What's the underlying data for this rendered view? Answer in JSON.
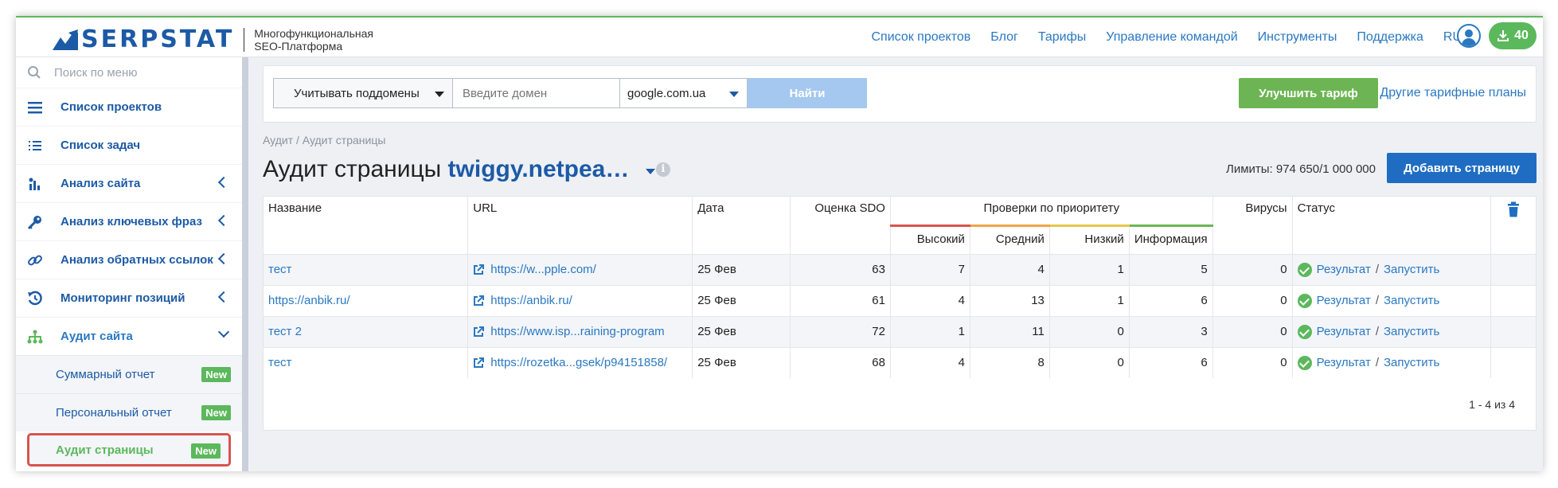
{
  "header": {
    "logo_text": "SERPSTAT",
    "logo_sub_line1": "Многофункциональная",
    "logo_sub_line2": "SEO-Платформа",
    "nav": [
      "Список проектов",
      "Блог",
      "Тарифы",
      "Управление командой",
      "Инструменты",
      "Поддержка"
    ],
    "lang": "RU",
    "download_count": "40"
  },
  "sidebar": {
    "search_placeholder": "Поиск по меню",
    "items": [
      {
        "label": "Список проектов",
        "icon": "list-icon"
      },
      {
        "label": "Список задач",
        "icon": "tasks-icon"
      },
      {
        "label": "Анализ сайта",
        "icon": "bar-chart-icon"
      },
      {
        "label": "Анализ ключевых фраз",
        "icon": "key-icon"
      },
      {
        "label": "Анализ обратных ссылок",
        "icon": "link-icon"
      },
      {
        "label": "Мониторинг позиций",
        "icon": "history-icon"
      },
      {
        "label": "Аудит сайта",
        "icon": "sitemap-icon"
      }
    ],
    "subitems": [
      {
        "label": "Суммарный отчет",
        "badge": "New"
      },
      {
        "label": "Персональный отчет",
        "badge": "New"
      },
      {
        "label": "Аудит страницы",
        "badge": "New"
      }
    ]
  },
  "search": {
    "subdomains_label": "Учитывать поддомены",
    "domain_placeholder": "Введите домен",
    "engine": "google.com.ua",
    "find_label": "Найти",
    "upgrade_label": "Улучшить тариф",
    "plans_link": "Другие тарифные планы"
  },
  "page": {
    "breadcrumb": "Аудит / Аудит страницы",
    "title": "Аудит страницы",
    "domain": "twiggy.netpea…",
    "limits": "Лимиты: 974 650/1 000 000",
    "add_label": "Добавить страницу"
  },
  "table": {
    "headers": {
      "name": "Название",
      "url": "URL",
      "date": "Дата",
      "score": "Оценка SDO",
      "priority": "Проверки по приоритету",
      "high": "Высокий",
      "mid": "Средний",
      "low": "Низкий",
      "info": "Информация",
      "viruses": "Вирусы",
      "status": "Статус"
    },
    "rows": [
      {
        "name": "тест",
        "url": "https://w...pple.com/",
        "date": "25 Фев",
        "score": "63",
        "high": "7",
        "mid": "4",
        "low": "1",
        "info": "5",
        "viruses": "0",
        "result": "Результат",
        "sep": "/",
        "run": "Запустить"
      },
      {
        "name": "https://anbik.ru/",
        "url": "https://anbik.ru/",
        "date": "25 Фев",
        "score": "61",
        "high": "4",
        "mid": "13",
        "low": "1",
        "info": "6",
        "viruses": "0",
        "result": "Результат",
        "sep": "/",
        "run": "Запустить"
      },
      {
        "name": "тест 2",
        "url": "https://www.isp...raining-program",
        "date": "25 Фев",
        "score": "72",
        "high": "1",
        "mid": "11",
        "low": "0",
        "info": "3",
        "viruses": "0",
        "result": "Результат",
        "sep": "/",
        "run": "Запустить"
      },
      {
        "name": "тест",
        "url": "https://rozetka...gsek/p94151858/",
        "date": "25 Фев",
        "score": "68",
        "high": "4",
        "mid": "8",
        "low": "0",
        "info": "6",
        "viruses": "0",
        "result": "Результат",
        "sep": "/",
        "run": "Запустить"
      }
    ],
    "pager": "1 - 4 из 4"
  },
  "colors": {
    "brand": "#1c5aa6",
    "link": "#2a78c2",
    "green": "#5cb85c",
    "highlight": "#d9534f"
  }
}
